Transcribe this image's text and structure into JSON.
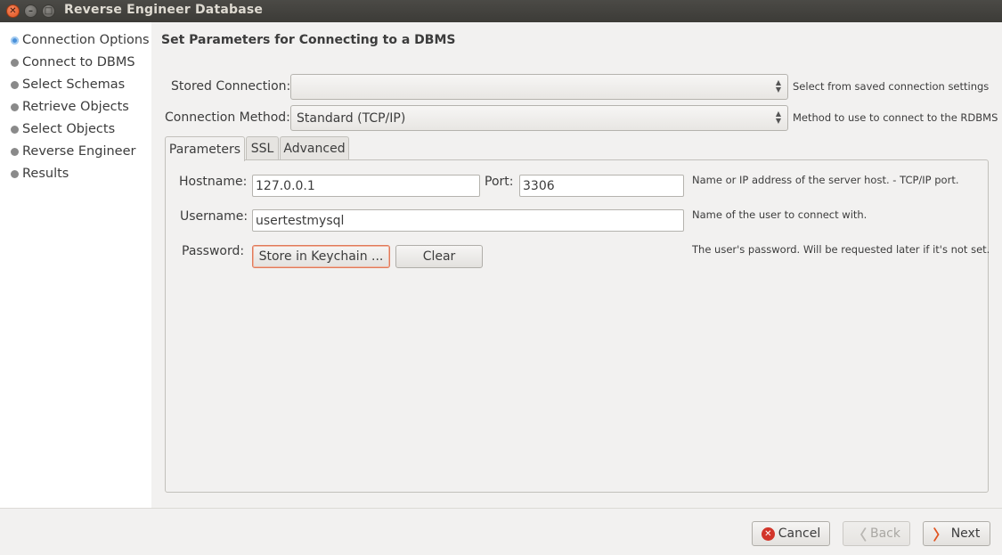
{
  "window": {
    "title": "Reverse Engineer Database",
    "close_glyph": "✕",
    "minimize_glyph": "–",
    "maximize_glyph": "□"
  },
  "sidebar": {
    "steps": [
      {
        "label": "Connection Options",
        "active": true
      },
      {
        "label": "Connect to DBMS",
        "active": false
      },
      {
        "label": "Select Schemas",
        "active": false
      },
      {
        "label": "Retrieve Objects",
        "active": false
      },
      {
        "label": "Select Objects",
        "active": false
      },
      {
        "label": "Reverse Engineer",
        "active": false
      },
      {
        "label": "Results",
        "active": false
      }
    ]
  },
  "main": {
    "heading": "Set Parameters for Connecting to a DBMS",
    "stored_connection": {
      "label": "Stored Connection:",
      "value": "",
      "hint": "Select from saved connection settings"
    },
    "connection_method": {
      "label": "Connection Method:",
      "value": "Standard (TCP/IP)",
      "hint": "Method to use to connect to the RDBMS"
    },
    "tabs": [
      {
        "label": "Parameters",
        "active": true
      },
      {
        "label": "SSL",
        "active": false
      },
      {
        "label": "Advanced",
        "active": false
      }
    ],
    "parameters": {
      "hostname_label": "Hostname:",
      "hostname_value": "127.0.0.1",
      "port_label": "Port:",
      "port_value": "3306",
      "hostname_hint": "Name or IP address of the server host. - TCP/IP port.",
      "username_label": "Username:",
      "username_value": "usertestmysql",
      "username_hint": "Name of the user to connect with.",
      "password_label": "Password:",
      "store_button": "Store in Keychain ...",
      "clear_button": "Clear",
      "password_hint": "The user's password. Will be requested later if it's not set."
    }
  },
  "footer": {
    "cancel": "Cancel",
    "back": "Back",
    "next": "Next",
    "cancel_glyph": "✕",
    "back_glyph": "〈",
    "next_glyph": "〉"
  },
  "colors": {
    "active_step_dot": "#4a90d9",
    "focus_border": "#e07a5a",
    "cancel_icon": "#d2352a",
    "next_icon": "#e0531f"
  },
  "icons": {
    "window_close": "close-icon",
    "window_minimize": "minimize-icon",
    "window_maximize": "maximize-icon",
    "combo_arrows": "combo-arrows-icon",
    "cancel": "cancel-icon",
    "back": "chevron-left-icon",
    "next": "chevron-right-icon"
  }
}
